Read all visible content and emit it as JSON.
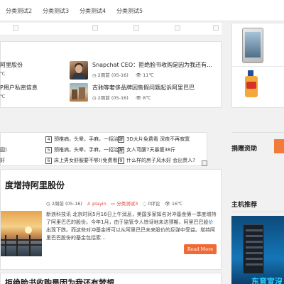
{
  "nav": {
    "items": [
      "分类测试2",
      "分类测试3",
      "分类测试4",
      "分类测试5"
    ]
  },
  "news": {
    "left": [
      {
        "title": "阿里股份",
        "temp": "℃"
      },
      {
        "title": "P用户私密信息",
        "temp": "℃"
      }
    ],
    "right": [
      {
        "title": "Snapchat CEO：拒绝脸书收购是因为我还有…",
        "date": "2周前 (05-16)",
        "temp": "11℃"
      },
      {
        "title": "古驰等奢侈品牌因售假问题起诉阿里巴巴",
        "date": "2周前 (05-16)",
        "temp": "8℃"
      }
    ]
  },
  "ticker": {
    "left": [
      "",
      "図)",
      "好"
    ],
    "mid": [
      {
        "n": "4",
        "text": "颈椎病，头晕，手麻，一招治好"
      },
      {
        "n": "5",
        "text": "颈椎病，头晕，手麻，一招治好"
      },
      {
        "n": "6",
        "text": "床上男女舒服要不够!(免费看)"
      }
    ],
    "right": [
      {
        "n": "7",
        "text": "3D大片免费看 深夜不再寂寞"
      },
      {
        "n": "8",
        "text": "女人弯腰7天暴瘦38斤"
      },
      {
        "n": "9",
        "text": "什么样的房子风水好 会出贵人?"
      }
    ]
  },
  "article": {
    "title": "度增持阿里股份",
    "date": "2周前 (05-16)",
    "author": "playin",
    "category": "分类测试3",
    "comments": "0评论",
    "temp": "16℃",
    "body_1": "新浪科技讯 北京时间5月16日上午消息，美国多家知名对冲基金第一季度增持了阿里巴巴的股份。今年1月，由于监管令人惊讶地未达预期，阿里巴巴股",
    "body_link": "价",
    "body_2": "出现下跌。而这些对冲基金将可以从阿里巴巴未来股价的反弹中受益。增持阿里巴巴股份的基金包括索…",
    "read_more": "Read More"
  },
  "next_article": {
    "title": "拒绝脸书收购是因为我还有梦想"
  },
  "sidebar": {
    "donate_title": "捐赠资助",
    "host_title": "主机推荐",
    "ad_text": "东育宣沒"
  },
  "icons": {
    "clock": "clock-icon",
    "user": "user-icon",
    "folder": "folder-icon",
    "comment": "comment-icon",
    "eye": "eye-icon"
  },
  "colors": {
    "accent": "#f06a35",
    "meta_red": "#e53d2f",
    "link": "#2a7ac1"
  }
}
